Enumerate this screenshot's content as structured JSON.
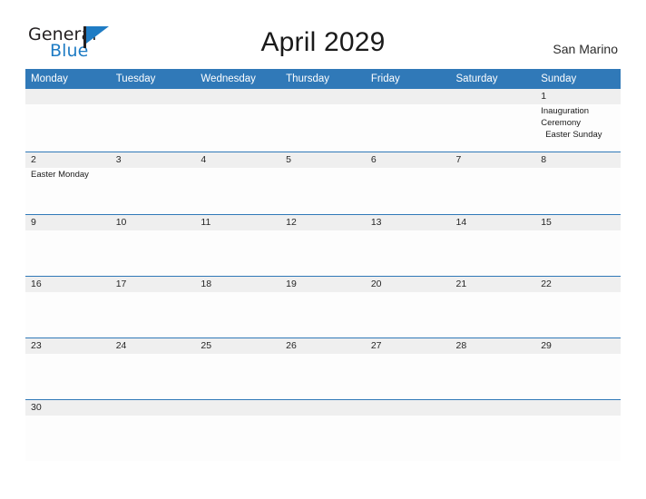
{
  "brand": {
    "name_part1": "General",
    "name_part2": "Blue",
    "flag_icon": "flag-triangle-icon",
    "color_dark": "#231f20",
    "color_blue": "#1f7cc4"
  },
  "header": {
    "title": "April 2029",
    "region": "San Marino"
  },
  "theme": {
    "header_blue": "#3079b8",
    "date_band_gray": "#efefef",
    "cell_white": "#fdfdfd",
    "text_dark": "#262626"
  },
  "calendar": {
    "weekdays": [
      "Monday",
      "Tuesday",
      "Wednesday",
      "Thursday",
      "Friday",
      "Saturday",
      "Sunday"
    ],
    "weeks": [
      {
        "days": [
          {
            "date": "",
            "events": []
          },
          {
            "date": "",
            "events": []
          },
          {
            "date": "",
            "events": []
          },
          {
            "date": "",
            "events": []
          },
          {
            "date": "",
            "events": []
          },
          {
            "date": "",
            "events": []
          },
          {
            "date": "1",
            "events": [
              "Inauguration",
              "Ceremony",
              "Easter Sunday"
            ]
          }
        ]
      },
      {
        "days": [
          {
            "date": "2",
            "events": [
              "Easter Monday"
            ]
          },
          {
            "date": "3",
            "events": []
          },
          {
            "date": "4",
            "events": []
          },
          {
            "date": "5",
            "events": []
          },
          {
            "date": "6",
            "events": []
          },
          {
            "date": "7",
            "events": []
          },
          {
            "date": "8",
            "events": []
          }
        ]
      },
      {
        "days": [
          {
            "date": "9",
            "events": []
          },
          {
            "date": "10",
            "events": []
          },
          {
            "date": "11",
            "events": []
          },
          {
            "date": "12",
            "events": []
          },
          {
            "date": "13",
            "events": []
          },
          {
            "date": "14",
            "events": []
          },
          {
            "date": "15",
            "events": []
          }
        ]
      },
      {
        "days": [
          {
            "date": "16",
            "events": []
          },
          {
            "date": "17",
            "events": []
          },
          {
            "date": "18",
            "events": []
          },
          {
            "date": "19",
            "events": []
          },
          {
            "date": "20",
            "events": []
          },
          {
            "date": "21",
            "events": []
          },
          {
            "date": "22",
            "events": []
          }
        ]
      },
      {
        "days": [
          {
            "date": "23",
            "events": []
          },
          {
            "date": "24",
            "events": []
          },
          {
            "date": "25",
            "events": []
          },
          {
            "date": "26",
            "events": []
          },
          {
            "date": "27",
            "events": []
          },
          {
            "date": "28",
            "events": []
          },
          {
            "date": "29",
            "events": []
          }
        ]
      },
      {
        "days": [
          {
            "date": "30",
            "events": []
          },
          {
            "date": "",
            "events": []
          },
          {
            "date": "",
            "events": []
          },
          {
            "date": "",
            "events": []
          },
          {
            "date": "",
            "events": []
          },
          {
            "date": "",
            "events": []
          },
          {
            "date": "",
            "events": []
          }
        ]
      }
    ]
  }
}
